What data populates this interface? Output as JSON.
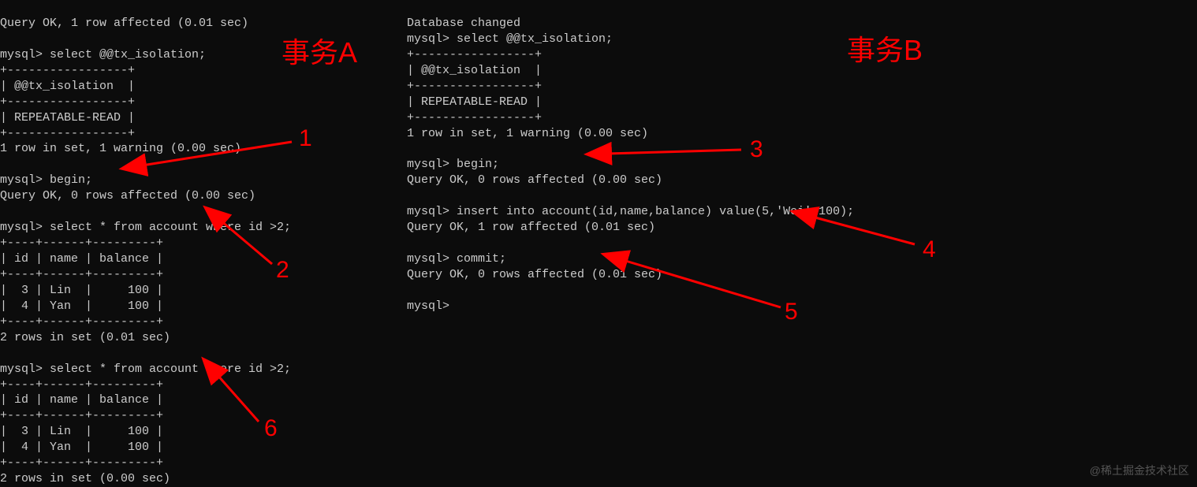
{
  "terminal_a": {
    "line01": "Query OK, 1 row affected (0.01 sec)",
    "line02": "",
    "line03": "mysql> select @@tx_isolation;",
    "line04": "+-----------------+",
    "line05": "| @@tx_isolation  |",
    "line06": "+-----------------+",
    "line07": "| REPEATABLE-READ |",
    "line08": "+-----------------+",
    "line09": "1 row in set, 1 warning (0.00 sec)",
    "line10": "",
    "line11": "mysql> begin;",
    "line12": "Query OK, 0 rows affected (0.00 sec)",
    "line13": "",
    "line14": "mysql> select * from account where id >2;",
    "line15": "+----+------+---------+",
    "line16": "| id | name | balance |",
    "line17": "+----+------+---------+",
    "line18": "|  3 | Lin  |     100 |",
    "line19": "|  4 | Yan  |     100 |",
    "line20": "+----+------+---------+",
    "line21": "2 rows in set (0.01 sec)",
    "line22": "",
    "line23": "mysql> select * from account where id >2;",
    "line24": "+----+------+---------+",
    "line25": "| id | name | balance |",
    "line26": "+----+------+---------+",
    "line27": "|  3 | Lin  |     100 |",
    "line28": "|  4 | Yan  |     100 |",
    "line29": "+----+------+---------+",
    "line30": "2 rows in set (0.00 sec)"
  },
  "terminal_b": {
    "line01": "Database changed",
    "line02": "mysql> select @@tx_isolation;",
    "line03": "+-----------------+",
    "line04": "| @@tx_isolation  |",
    "line05": "+-----------------+",
    "line06": "| REPEATABLE-READ |",
    "line07": "+-----------------+",
    "line08": "1 row in set, 1 warning (0.00 sec)",
    "line09": "",
    "line10": "mysql> begin;",
    "line11": "Query OK, 0 rows affected (0.00 sec)",
    "line12": "",
    "line13": "mysql> insert into account(id,name,balance) value(5,'Wei',100);",
    "line14": "Query OK, 1 row affected (0.01 sec)",
    "line15": "",
    "line16": "mysql> commit;",
    "line17": "Query OK, 0 rows affected (0.01 sec)",
    "line18": "",
    "line19": "mysql> "
  },
  "annotations": {
    "title_a": "事务A",
    "title_b": "事务B",
    "num1": "1",
    "num2": "2",
    "num3": "3",
    "num4": "4",
    "num5": "5",
    "num6": "6"
  },
  "watermark": "@稀土掘金技术社区"
}
